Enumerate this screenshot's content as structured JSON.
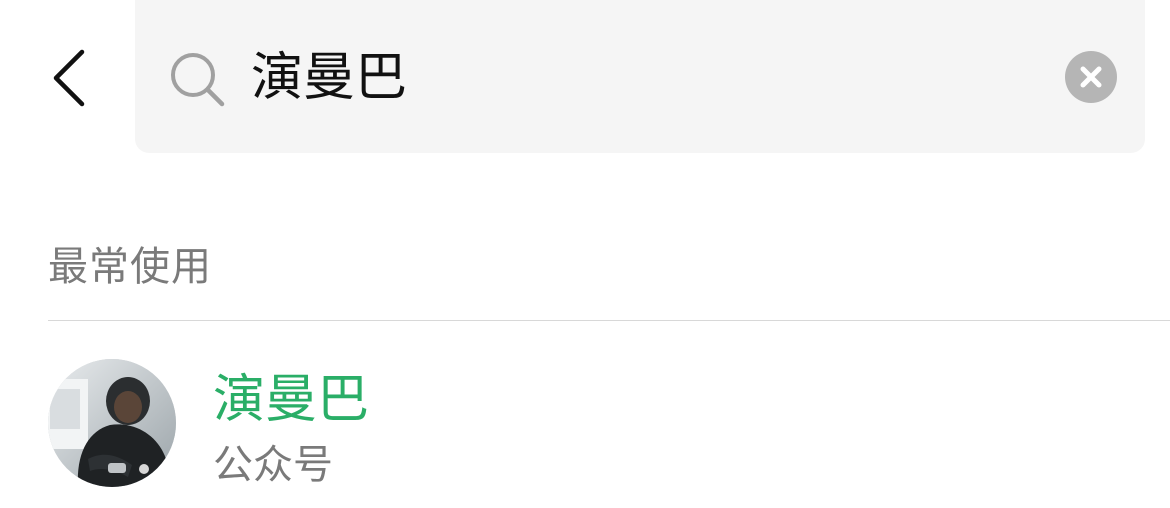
{
  "search": {
    "query": "演曼巴"
  },
  "section": {
    "header": "最常使用"
  },
  "results": [
    {
      "title": "演曼巴",
      "subtitle": "公众号"
    }
  ],
  "icons": {
    "back": "chevron-left-icon",
    "search": "search-icon",
    "clear": "clear-icon"
  },
  "colors": {
    "search_bar_bg": "#f5f5f5",
    "title_green": "#2aae67",
    "secondary_text": "#7a7a7a",
    "clear_button": "#b5b5b5"
  }
}
